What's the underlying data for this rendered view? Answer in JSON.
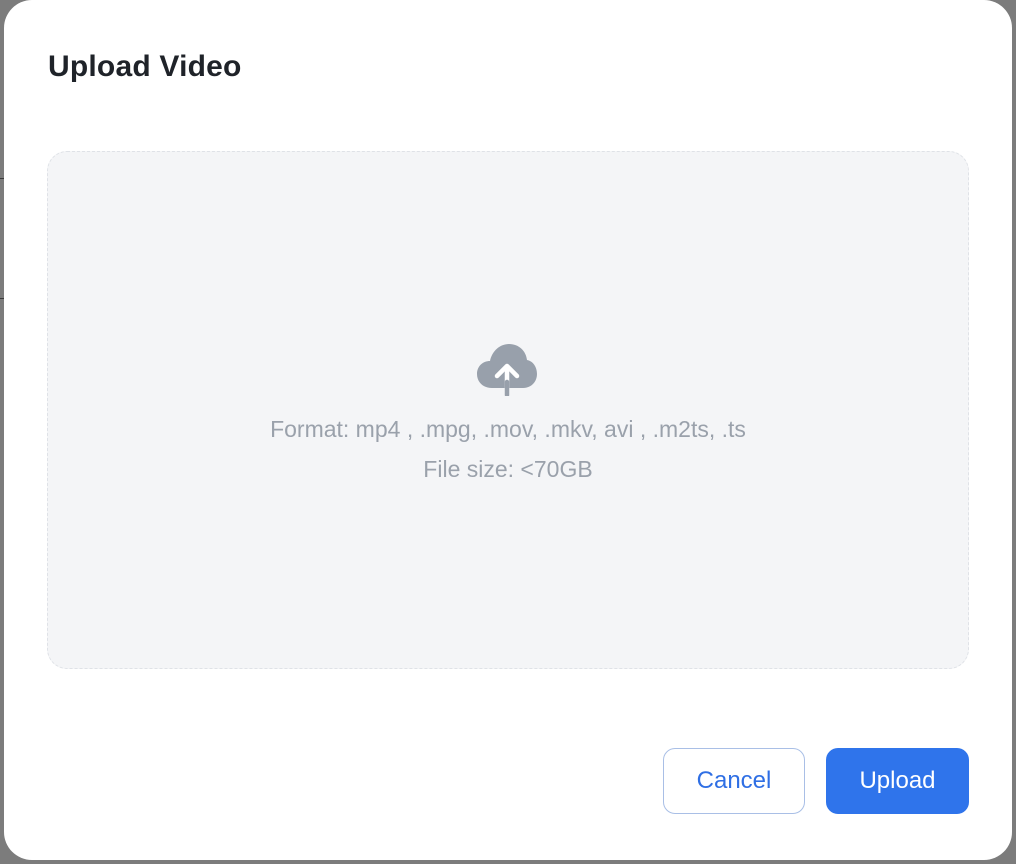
{
  "dialog": {
    "title": "Upload Video"
  },
  "dropzone": {
    "icon": "cloud-upload-icon",
    "format_text": "Format: mp4 , .mpg, .mov, .mkv, avi , .m2ts, .ts",
    "size_text": "File size: <70GB"
  },
  "actions": {
    "cancel_label": "Cancel",
    "upload_label": "Upload"
  },
  "colors": {
    "primary": "#2f74eb",
    "muted_text": "#9aa1ab",
    "title_text": "#1f2329",
    "dropzone_bg": "#f4f5f7"
  }
}
